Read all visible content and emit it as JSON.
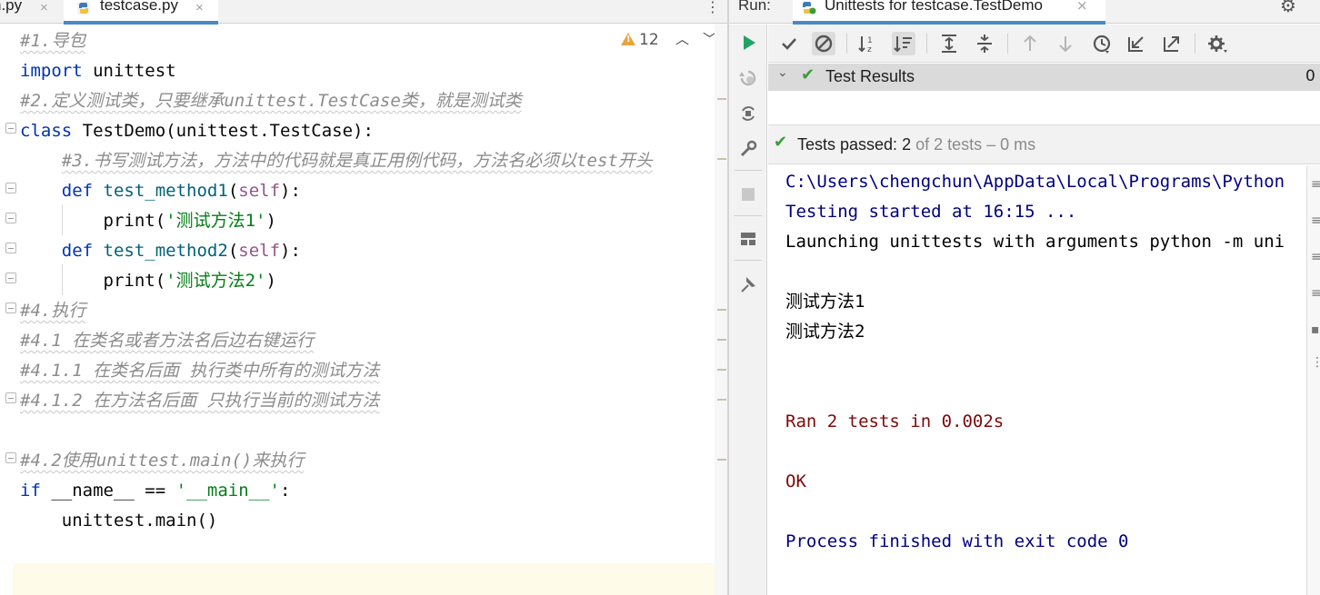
{
  "editor": {
    "tabs": [
      {
        "label": "n.py",
        "close": "×"
      },
      {
        "label": "testcase.py",
        "close": "×"
      }
    ],
    "menu_icon": "⋮",
    "inspection": {
      "icon": "warning-icon",
      "count": "12",
      "up": "︿",
      "down": "﹀"
    },
    "lines": [
      [
        {
          "t": "#1.导包",
          "c": "cmt"
        }
      ],
      [
        {
          "t": "import",
          "c": "kw"
        },
        {
          "t": " unittest",
          "c": ""
        }
      ],
      [
        {
          "t": "#2.定义测试类，只要继承unittest.TestCase类，就是测试类",
          "c": "cmt"
        }
      ],
      [
        {
          "t": "class",
          "c": "kw"
        },
        {
          "t": " TestDemo(unittest.TestCase):",
          "c": ""
        }
      ],
      [
        {
          "t": "    ",
          "c": ""
        },
        {
          "t": "#3.书写测试方法，方法中的代码就是真正用例代码，方法名必须以test开头",
          "c": "cmt"
        }
      ],
      [
        {
          "t": "    ",
          "c": ""
        },
        {
          "t": "def",
          "c": "kw"
        },
        {
          "t": " test_method1",
          "c": "fn"
        },
        {
          "t": "(",
          "c": ""
        },
        {
          "t": "self",
          "c": "slf"
        },
        {
          "t": "):",
          "c": ""
        }
      ],
      [
        {
          "t": "        print(",
          "c": ""
        },
        {
          "t": "'测试方法1'",
          "c": "str"
        },
        {
          "t": ")",
          "c": ""
        }
      ],
      [
        {
          "t": "    ",
          "c": ""
        },
        {
          "t": "def",
          "c": "kw"
        },
        {
          "t": " test_method2",
          "c": "fn"
        },
        {
          "t": "(",
          "c": ""
        },
        {
          "t": "self",
          "c": "slf"
        },
        {
          "t": "):",
          "c": ""
        }
      ],
      [
        {
          "t": "        print(",
          "c": ""
        },
        {
          "t": "'测试方法2'",
          "c": "str"
        },
        {
          "t": ")",
          "c": ""
        }
      ],
      [
        {
          "t": "#4.执行",
          "c": "cmt"
        }
      ],
      [
        {
          "t": "#4.1 在类名或者方法名后边右键运行",
          "c": "cmt"
        }
      ],
      [
        {
          "t": "#4.1.1 在类名后面 执行类中所有的测试方法",
          "c": "cmt"
        }
      ],
      [
        {
          "t": "#4.1.2 在方法名后面 只执行当前的测试方法",
          "c": "cmt"
        }
      ],
      [],
      [
        {
          "t": "#4.2使用unittest.main()来执行",
          "c": "cmt"
        }
      ],
      [
        {
          "t": "if",
          "c": "kw"
        },
        {
          "t": " __name__ == ",
          "c": ""
        },
        {
          "t": "'__main__'",
          "c": "str"
        },
        {
          "t": ":",
          "c": ""
        }
      ],
      [
        {
          "t": "    unittest.main()",
          "c": ""
        }
      ]
    ]
  },
  "run": {
    "label": "Run:",
    "tab_title": "Unittests for testcase.TestDemo",
    "tab_close": "×",
    "settings_icon": "⚙",
    "tree": {
      "chevron": "⌄",
      "label": "Test Results",
      "right_value": "0"
    },
    "status": {
      "prefix": "Tests passed: ",
      "passed": "2",
      "suffix": " of 2 tests – 0 ms"
    },
    "console": [
      {
        "text": "C:\\Users\\chengchun\\AppData\\Local\\Programs\\Python",
        "c": "c-blue"
      },
      {
        "text": "Testing started at 16:15 ...",
        "c": "c-blue"
      },
      {
        "text": "Launching unittests with arguments python -m uni",
        "c": "c-plain"
      },
      {
        "text": "",
        "c": "c-plain"
      },
      {
        "text": "测试方法1",
        "c": "c-plain"
      },
      {
        "text": "测试方法2",
        "c": "c-plain"
      },
      {
        "text": "",
        "c": "c-plain"
      },
      {
        "text": "",
        "c": "c-plain"
      },
      {
        "text": "Ran 2 tests in 0.002s",
        "c": "c-red"
      },
      {
        "text": "",
        "c": "c-plain"
      },
      {
        "text": "OK",
        "c": "c-red"
      },
      {
        "text": "",
        "c": "c-plain"
      },
      {
        "text": "Process finished with exit code 0",
        "c": "c-blue"
      }
    ]
  },
  "icons": {
    "side": [
      "run-icon",
      "rerun-failed-icon",
      "toggle-auto-test-icon",
      "wrench-icon",
      "stop-icon",
      "layout-icon",
      "pin-icon"
    ],
    "toolbar": [
      "show-passed-icon",
      "show-ignored-icon",
      "sort-alpha-icon",
      "sort-duration-icon",
      "expand-all-icon",
      "collapse-all-icon",
      "previous-failed-icon",
      "next-failed-icon",
      "history-icon",
      "import-tests-icon",
      "export-tests-icon",
      "settings-icon"
    ]
  },
  "colors": {
    "accent": "#4a88c7",
    "pass_green": "#3e9b3e",
    "run_green": "#21a366",
    "keyword": "#0033b3",
    "string": "#067d17",
    "comment": "#8c8c8c"
  }
}
